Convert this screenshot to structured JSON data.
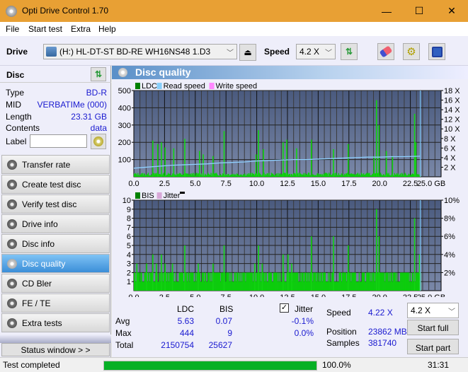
{
  "window": {
    "title": "Opti Drive Control 1.70",
    "minimize": "—",
    "maximize": "☐",
    "close": "✕"
  },
  "menu": [
    "File",
    "Start test",
    "Extra",
    "Help"
  ],
  "toolbar": {
    "drive_label": "Drive",
    "drive_value": "(H:)  HL-DT-ST BD-RE  WH16NS48 1.D3",
    "speed_label": "Speed",
    "speed_value": "4.2 X"
  },
  "disc": {
    "header": "Disc",
    "rows": [
      {
        "k": "Type",
        "v": "BD-R"
      },
      {
        "k": "MID",
        "v": "VERBATIMe (000)"
      },
      {
        "k": "Length",
        "v": "23.31 GB"
      },
      {
        "k": "Contents",
        "v": "data"
      }
    ],
    "label_label": "Label",
    "label_value": ""
  },
  "nav": [
    {
      "label": "Transfer rate"
    },
    {
      "label": "Create test disc"
    },
    {
      "label": "Verify test disc"
    },
    {
      "label": "Drive info"
    },
    {
      "label": "Disc info"
    },
    {
      "label": "Disc quality",
      "active": true
    },
    {
      "label": "CD Bler"
    },
    {
      "label": "FE / TE"
    },
    {
      "label": "Extra tests"
    }
  ],
  "status_window_btn": "Status window > >",
  "panel_title": "Disc quality",
  "chart_data": [
    {
      "type": "bar",
      "title": "LDC",
      "legend": [
        "LDC",
        "Read speed",
        "Write speed"
      ],
      "legend_colors": [
        "#008000",
        "#87cefa",
        "#ff88ff"
      ],
      "x_ticks": [
        "0.0",
        "2.5",
        "5.0",
        "7.5",
        "10.0",
        "12.5",
        "15.0",
        "17.5",
        "20.0",
        "22.5",
        "25.0 GB"
      ],
      "xlim": [
        0,
        25
      ],
      "y_ticks": [
        "100",
        "200",
        "300",
        "400",
        "500"
      ],
      "ylim": [
        0,
        500
      ],
      "y2_ticks": [
        "2 X",
        "4 X",
        "6 X",
        "8 X",
        "10 X",
        "12 X",
        "14 X",
        "16 X",
        "18 X"
      ],
      "y2lim": [
        0,
        18
      ],
      "end_marker_gb": 23.31,
      "read_speed": {
        "x": [
          0,
          1,
          2,
          3,
          4,
          5,
          6,
          7,
          8,
          9,
          10,
          11,
          12,
          13,
          14,
          15,
          16,
          17,
          18,
          19,
          20,
          21,
          22,
          23.31
        ],
        "y": [
          1.8,
          2.0,
          2.2,
          2.4,
          2.5,
          2.6,
          2.7,
          2.9,
          3.0,
          3.1,
          3.3,
          3.4,
          3.5,
          3.6,
          3.6,
          3.7,
          3.8,
          3.9,
          4.0,
          4.1,
          4.1,
          4.2,
          4.2,
          4.3
        ]
      },
      "spikes": [
        {
          "x": 1.5,
          "y": 210
        },
        {
          "x": 1.9,
          "y": 190
        },
        {
          "x": 2.2,
          "y": 200
        },
        {
          "x": 2.5,
          "y": 170
        },
        {
          "x": 3.2,
          "y": 165
        },
        {
          "x": 4.1,
          "y": 220
        },
        {
          "x": 5.3,
          "y": 150
        },
        {
          "x": 5.6,
          "y": 130
        },
        {
          "x": 6.4,
          "y": 120
        },
        {
          "x": 7.3,
          "y": 265
        },
        {
          "x": 9.9,
          "y": 130
        },
        {
          "x": 10.1,
          "y": 270
        },
        {
          "x": 10.5,
          "y": 160
        },
        {
          "x": 12.1,
          "y": 200
        },
        {
          "x": 12.4,
          "y": 215
        },
        {
          "x": 13.2,
          "y": 165
        },
        {
          "x": 14.4,
          "y": 215
        },
        {
          "x": 16.2,
          "y": 160
        },
        {
          "x": 17.4,
          "y": 190
        },
        {
          "x": 19.5,
          "y": 120
        },
        {
          "x": 19.7,
          "y": 444
        },
        {
          "x": 19.9,
          "y": 300
        },
        {
          "x": 20.5,
          "y": 150
        },
        {
          "x": 21.0,
          "y": 120
        },
        {
          "x": 22.8,
          "y": 365
        },
        {
          "x": 22.9,
          "y": 200
        }
      ],
      "baseline_avg": 5.63
    },
    {
      "type": "bar",
      "title": "BIS",
      "legend": [
        "BIS",
        "Jitter"
      ],
      "legend_colors": [
        "#008000",
        "#d8a8d8"
      ],
      "x_ticks": [
        "0.0",
        "2.5",
        "5.0",
        "7.5",
        "10.0",
        "12.5",
        "15.0",
        "17.5",
        "20.0",
        "22.5",
        "25.0 GB"
      ],
      "xlim": [
        0,
        25
      ],
      "y_ticks": [
        "1",
        "2",
        "3",
        "4",
        "5",
        "6",
        "7",
        "8",
        "9",
        "10"
      ],
      "ylim": [
        0,
        10
      ],
      "y2_ticks": [
        "2%",
        "4%",
        "6%",
        "8%",
        "10%"
      ],
      "y2lim": [
        0,
        10
      ],
      "end_marker_gb": 23.31,
      "spikes": [
        {
          "x": 0.2,
          "y": 3
        },
        {
          "x": 1.0,
          "y": 3
        },
        {
          "x": 1.5,
          "y": 4
        },
        {
          "x": 1.8,
          "y": 3
        },
        {
          "x": 2.2,
          "y": 4
        },
        {
          "x": 2.5,
          "y": 3
        },
        {
          "x": 3.1,
          "y": 3
        },
        {
          "x": 4.1,
          "y": 5
        },
        {
          "x": 5.2,
          "y": 3
        },
        {
          "x": 6.4,
          "y": 3
        },
        {
          "x": 7.3,
          "y": 5
        },
        {
          "x": 9.8,
          "y": 3
        },
        {
          "x": 10.1,
          "y": 5
        },
        {
          "x": 10.4,
          "y": 3
        },
        {
          "x": 12.1,
          "y": 4
        },
        {
          "x": 12.5,
          "y": 4
        },
        {
          "x": 12.8,
          "y": 3
        },
        {
          "x": 14.4,
          "y": 6
        },
        {
          "x": 16.2,
          "y": 6
        },
        {
          "x": 17.4,
          "y": 5
        },
        {
          "x": 19.7,
          "y": 9
        },
        {
          "x": 19.9,
          "y": 6
        },
        {
          "x": 22.8,
          "y": 8
        },
        {
          "x": 23.2,
          "y": 4
        }
      ],
      "baseline": 2
    }
  ],
  "stats": {
    "col_ldc": "LDC",
    "col_bis": "BIS",
    "rows": [
      {
        "k": "Avg",
        "ldc": "5.63",
        "bis": "0.07",
        "jitter": "-0.1%"
      },
      {
        "k": "Max",
        "ldc": "444",
        "bis": "9",
        "jitter": "0.0%"
      },
      {
        "k": "Total",
        "ldc": "2150754",
        "bis": "25627",
        "jitter": ""
      }
    ],
    "jitter_label": "Jitter",
    "jitter_checked": true,
    "speed_label": "Speed",
    "speed_value": "4.22 X",
    "position_label": "Position",
    "position_value": "23862 MB",
    "samples_label": "Samples",
    "samples_value": "381740",
    "speed_select": "4.2 X",
    "start_full": "Start full",
    "start_part": "Start part"
  },
  "status": {
    "text": "Test completed",
    "progress": 100.0,
    "progress_text": "100.0%",
    "time": "31:31"
  }
}
